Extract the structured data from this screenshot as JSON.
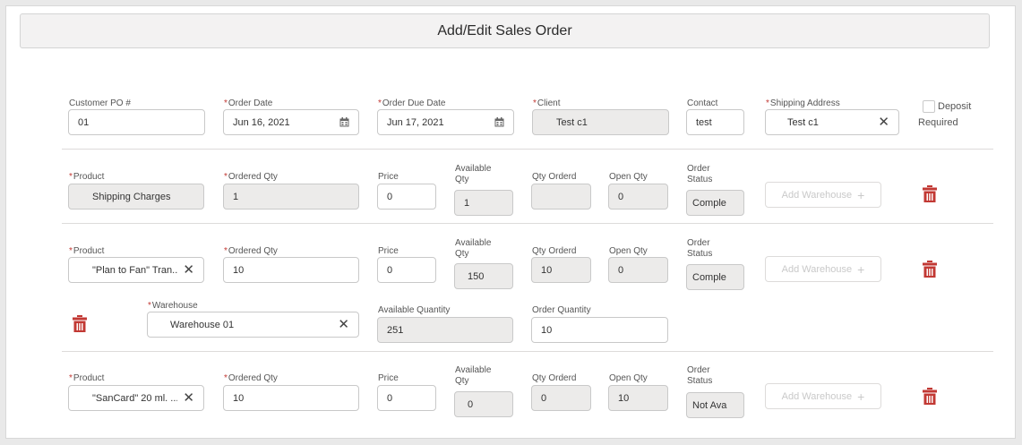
{
  "title": "Add/Edit Sales Order",
  "order": {
    "customer_po_label": "Customer PO #",
    "customer_po_value": "01",
    "order_date_label": "Order Date",
    "order_date_value": "Jun 16, 2021",
    "due_date_label": "Order Due Date",
    "due_date_value": "Jun 17, 2021",
    "client_label": "Client",
    "client_value": "Test c1",
    "contact_label": "Contact",
    "contact_value": "test",
    "shipping_label": "Shipping Address",
    "shipping_value": "Test c1",
    "deposit_label_1": "Deposit",
    "deposit_label_2": "Required"
  },
  "labels": {
    "required": "*",
    "product": "Product",
    "ordered_qty": "Ordered Qty",
    "price": "Price",
    "available_qty_1": "Available",
    "available_qty_2": "Qty",
    "qty_orderd": "Qty Orderd",
    "open_qty": "Open Qty",
    "order_status_1": "Order",
    "order_status_2": "Status",
    "add_warehouse": "Add Warehouse",
    "add_icon": "+",
    "clear_icon": "✕",
    "warehouse": "Warehouse",
    "available_quantity": "Available Quantity",
    "order_quantity": "Order Quantity"
  },
  "lines": [
    {
      "product": "Shipping Charges",
      "ordered_qty": "1",
      "price": "0",
      "available_qty": "1",
      "qty_orderd": "",
      "open_qty": "0",
      "status": "Comple"
    },
    {
      "product": "\"Plan to Fan\" Tran...",
      "ordered_qty": "10",
      "price": "0",
      "available_qty": "150",
      "qty_orderd": "10",
      "open_qty": "0",
      "status": "Comple",
      "warehouse": {
        "name": "Warehouse 01",
        "available_quantity": "251",
        "order_quantity": "10"
      }
    },
    {
      "product": "\"SanCard\" 20 ml. ...",
      "ordered_qty": "10",
      "price": "0",
      "available_qty": "0",
      "qty_orderd": "0",
      "open_qty": "10",
      "status": "Not Ava"
    }
  ],
  "colors": {
    "delete_red": "#c23934",
    "header_bg": "#f3f2f2",
    "disabled_bg": "#ecebea"
  }
}
